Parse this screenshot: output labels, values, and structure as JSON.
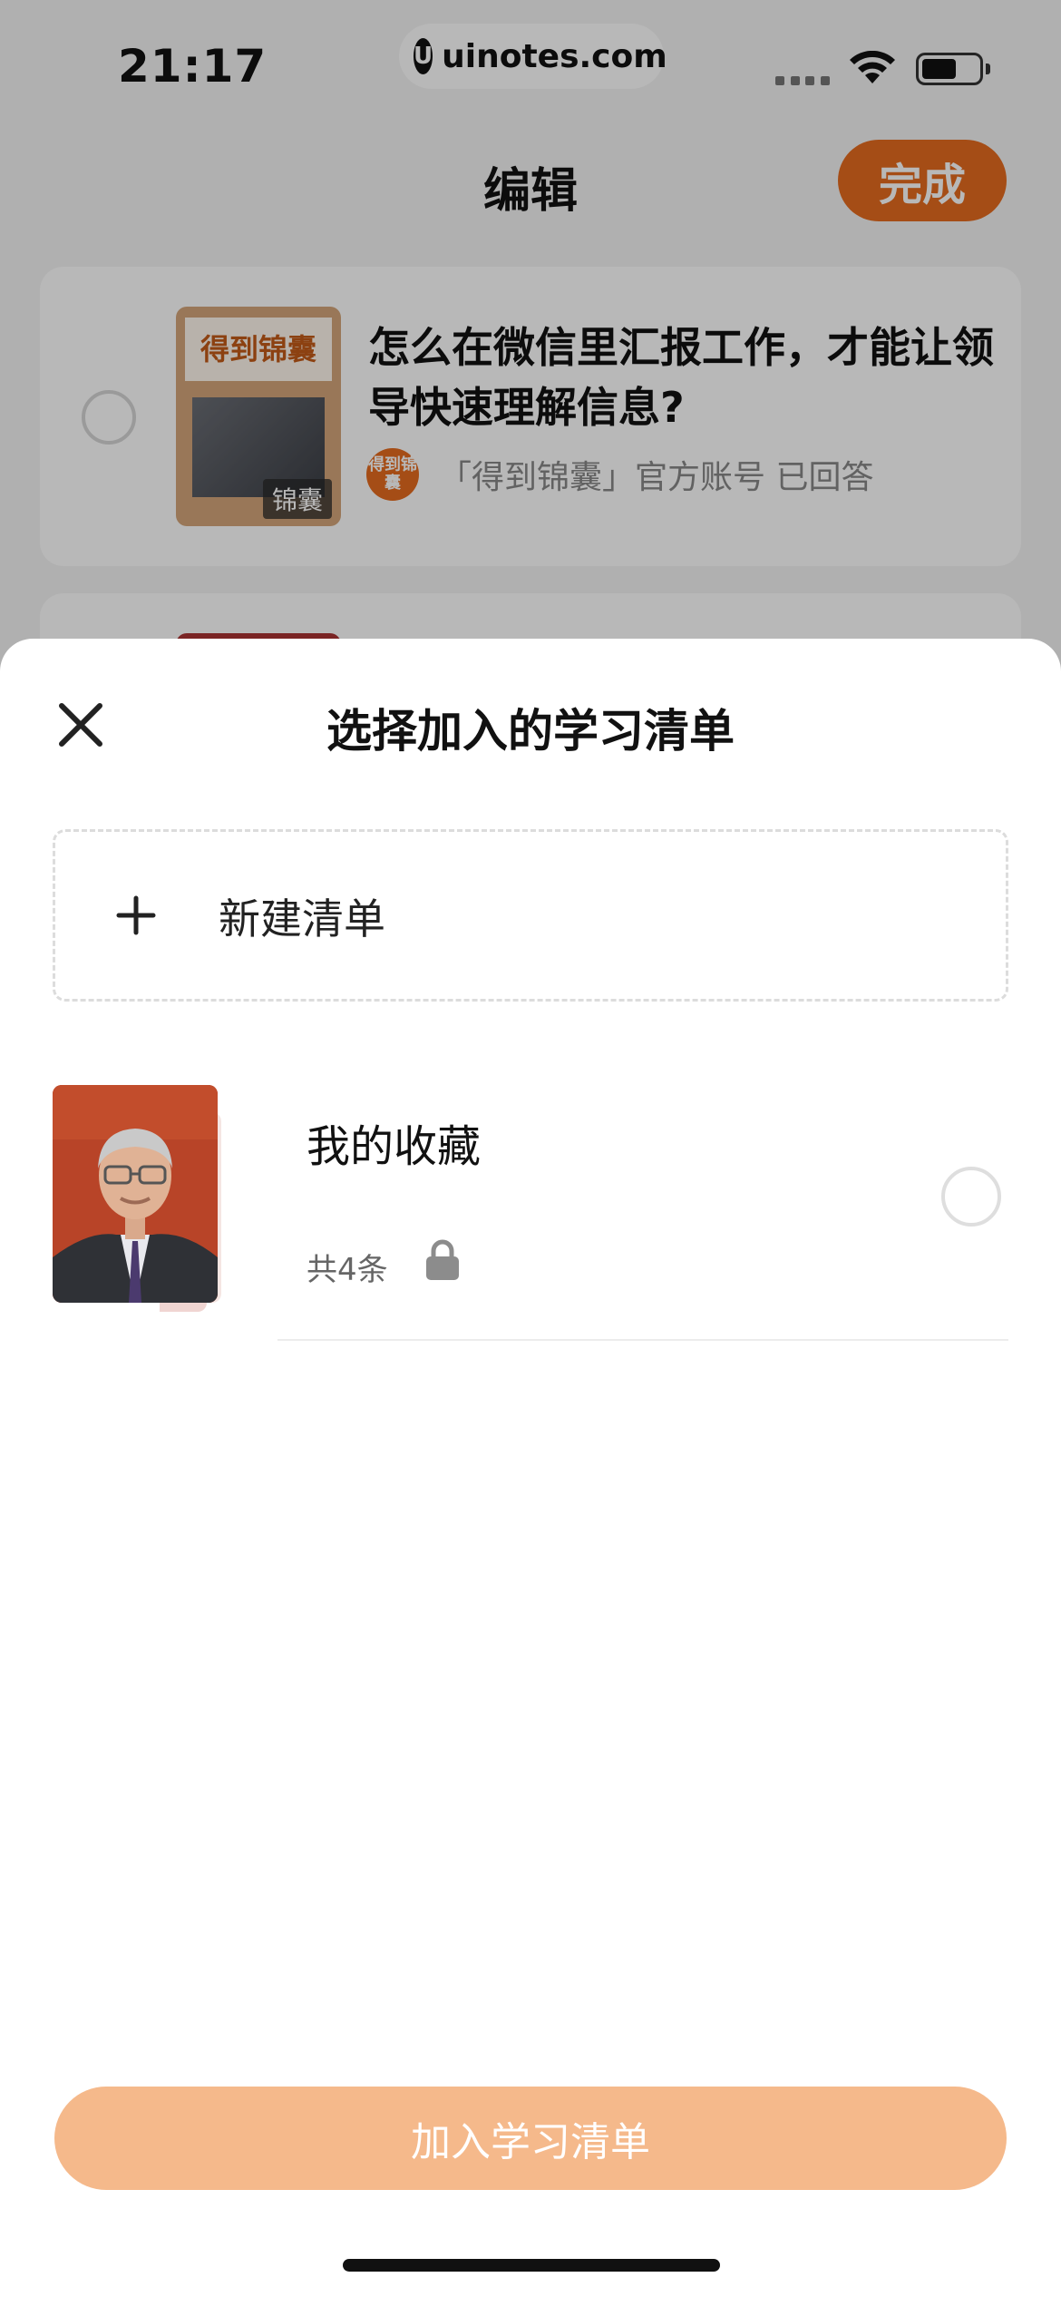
{
  "status_bar": {
    "time": "21:17",
    "url": "uinotes.com",
    "url_logo": "U"
  },
  "nav": {
    "title": "编辑",
    "done_label": "完成"
  },
  "background_card": {
    "thumb_label": "得到锦囊",
    "thumb_tag": "锦囊",
    "title": "怎么在微信里汇报工作，才能让领导快速理解信息?",
    "avatar_text": "得到锦囊",
    "subtitle": "「得到锦囊」官方账号 已回答"
  },
  "sheet": {
    "title": "选择加入的学习清单",
    "close_icon": "close-icon",
    "new_list_label": "新建清单",
    "lists": [
      {
        "title": "我的收藏",
        "count": "共4条",
        "private_icon": "lock-icon",
        "selected": false
      }
    ],
    "add_button_label": "加入学习清单"
  },
  "colors": {
    "accent": "#e56b1f",
    "add_button_disabled": "#f5b98b"
  }
}
